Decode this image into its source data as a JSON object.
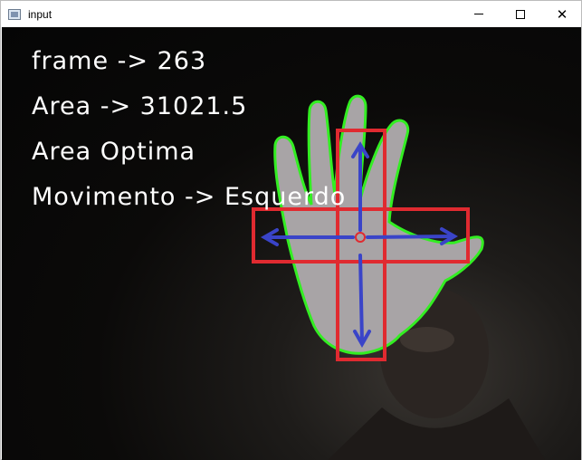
{
  "window": {
    "title": "input",
    "controls": {
      "minimize": "minimize",
      "maximize": "maximize",
      "close": "✕"
    }
  },
  "overlay": {
    "line1": "frame -> 263",
    "line2": "Area -> 31021.5",
    "line3": "Area Optima",
    "line4": "Movimento -> Esquerdo"
  },
  "colors": {
    "hand_contour": "#33ee22",
    "boxes": "#e02a30",
    "arrows": "#3a44c8",
    "text": "#ffffff"
  }
}
